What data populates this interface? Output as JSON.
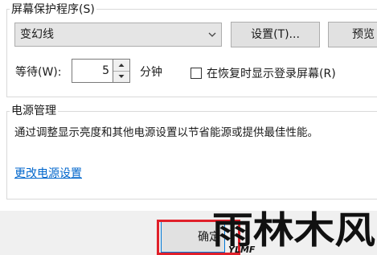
{
  "screensaver": {
    "group_label": "屏幕保护程序(S)",
    "selected": "变幻线",
    "settings_button": "设置(T)...",
    "preview_button": "预览",
    "wait_label": "等待(W):",
    "wait_value": "5",
    "wait_unit": "分钟",
    "resume_checkbox_label": "在恢复时显示登录屏幕(R)",
    "resume_checked": false
  },
  "power": {
    "group_label": "电源管理",
    "description": "通过调整显示亮度和其他电源设置以节省能源或提供最佳性能。",
    "link": "更改电源设置"
  },
  "footer": {
    "ok_button": "确定"
  },
  "watermark": {
    "main": "雨林木风",
    "sub": "YLMF"
  }
}
